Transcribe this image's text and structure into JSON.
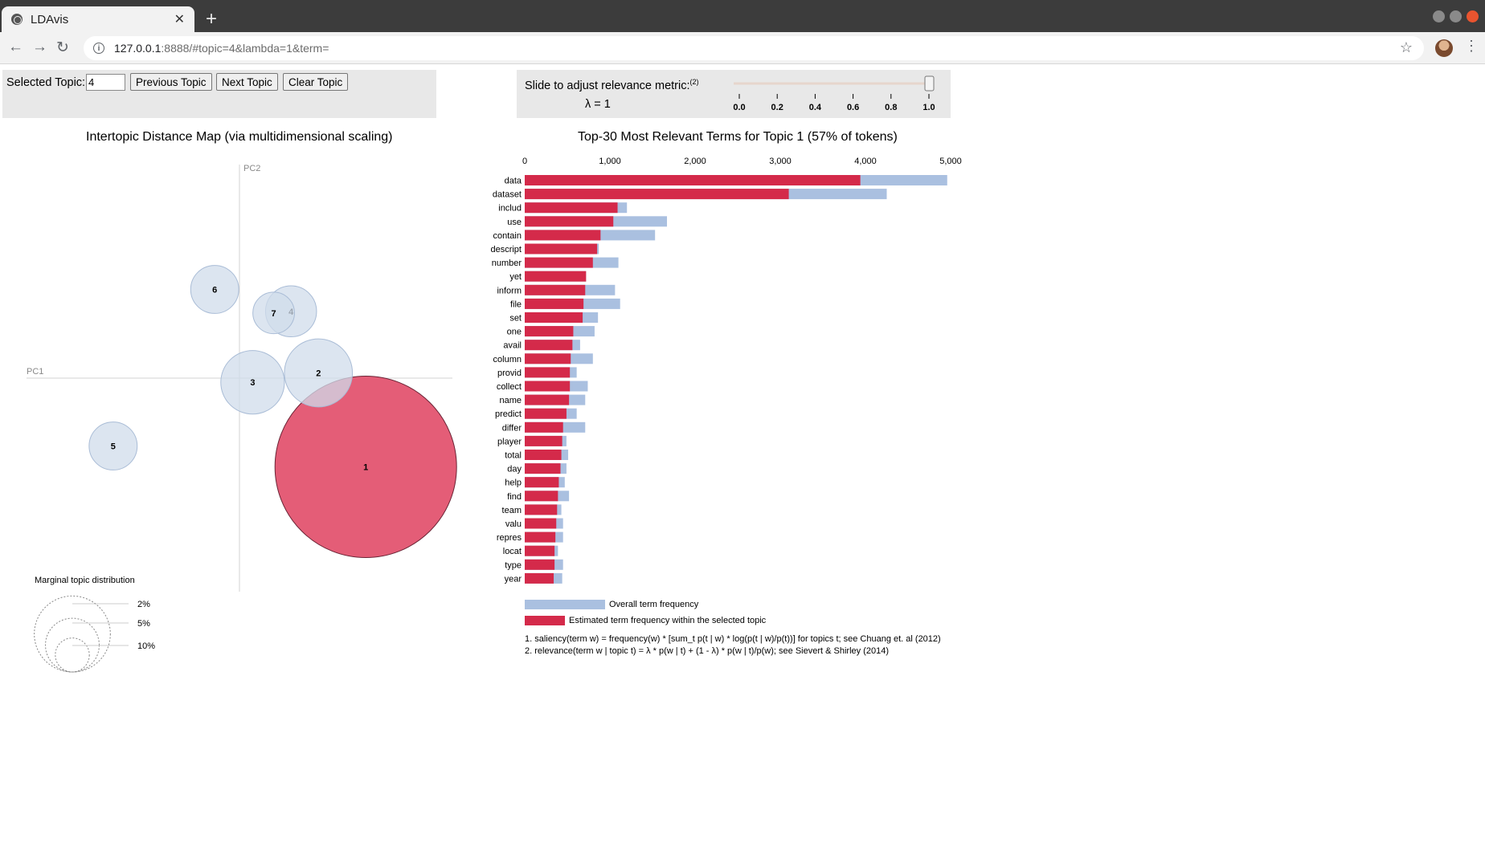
{
  "browser": {
    "tab_title": "LDAvis",
    "url_host": "127.0.0.1",
    "url_rest": ":8888/#topic=4&lambda=1&term=",
    "new_tab_label": "+",
    "close_label": "✕"
  },
  "controls": {
    "selected_topic_label": "Selected Topic:",
    "selected_topic_value": "4",
    "prev_label": "Previous Topic",
    "next_label": "Next Topic",
    "clear_label": "Clear Topic",
    "slide_label": "Slide to adjust relevance metric:",
    "slide_sup": "(2)",
    "lambda_label": "λ = 1",
    "lambda_value": 1.0,
    "slider_ticks": [
      "0.0",
      "0.2",
      "0.4",
      "0.6",
      "0.8",
      "1.0"
    ]
  },
  "map": {
    "title": "Intertopic Distance Map (via multidimensional scaling)",
    "pc1_label": "PC1",
    "pc2_label": "PC2",
    "legend_title": "Marginal topic distribution",
    "legend_items": [
      "2%",
      "5%",
      "10%"
    ],
    "topics": [
      {
        "id": "1",
        "selected": true
      },
      {
        "id": "2",
        "selected": false
      },
      {
        "id": "3",
        "selected": false
      },
      {
        "id": "4",
        "selected": false
      },
      {
        "id": "5",
        "selected": false
      },
      {
        "id": "6",
        "selected": false
      },
      {
        "id": "7",
        "selected": false
      }
    ]
  },
  "bars_panel": {
    "title": "Top-30 Most Relevant Terms for Topic 1 (57% of tokens)",
    "legend_overall": "Overall term frequency",
    "legend_estimated": "Estimated term frequency within the selected topic",
    "footnote1": "1. saliency(term w) = frequency(w) * [sum_t p(t | w) * log(p(t | w)/p(t))] for topics t; see Chuang et. al (2012)",
    "footnote2": "2. relevance(term w | topic t) = λ * p(w | t) + (1 - λ) * p(w | t)/p(w); see Sievert & Shirley (2014)"
  },
  "colors": {
    "overall": "#aac0e0",
    "estimated": "#d42a4a",
    "topic_circle": "#d0dceb",
    "selected_circle": "#e45d77"
  },
  "chart_data": [
    {
      "type": "bar",
      "orientation": "horizontal",
      "title": "Top-30 Most Relevant Terms for Topic 1 (57% of tokens)",
      "xlim": [
        0,
        5000
      ],
      "x_ticks": [
        "0",
        "1,000",
        "2,000",
        "3,000",
        "4,000",
        "5,000"
      ],
      "categories": [
        "data",
        "dataset",
        "includ",
        "use",
        "contain",
        "descript",
        "number",
        "yet",
        "inform",
        "file",
        "set",
        "one",
        "avail",
        "column",
        "provid",
        "collect",
        "name",
        "predict",
        "differ",
        "player",
        "total",
        "day",
        "help",
        "find",
        "team",
        "valu",
        "repres",
        "locat",
        "type",
        "year"
      ],
      "series": [
        {
          "name": "Overall term frequency",
          "values": [
            4960,
            4250,
            1200,
            1670,
            1530,
            870,
            1100,
            720,
            1060,
            1120,
            860,
            820,
            650,
            800,
            610,
            740,
            710,
            610,
            710,
            490,
            510,
            490,
            470,
            520,
            430,
            450,
            450,
            390,
            450,
            440
          ]
        },
        {
          "name": "Estimated term frequency within the selected topic",
          "values": [
            3940,
            3100,
            1090,
            1040,
            890,
            850,
            800,
            720,
            710,
            690,
            680,
            570,
            560,
            540,
            530,
            530,
            520,
            490,
            450,
            440,
            430,
            420,
            400,
            390,
            380,
            370,
            360,
            350,
            350,
            340
          ]
        }
      ]
    },
    {
      "type": "scatter",
      "title": "Intertopic Distance Map (via multidimensional scaling)",
      "xlabel": "PC1",
      "ylabel": "PC2",
      "points": [
        {
          "label": "1",
          "x": 0.24,
          "y": -0.17,
          "size_pct": 57
        },
        {
          "label": "2",
          "x": 0.15,
          "y": 0.01,
          "size_pct": 8
        },
        {
          "label": "3",
          "x": 0.025,
          "y": -0.008,
          "size_pct": 7
        },
        {
          "label": "4",
          "x": 0.098,
          "y": 0.128,
          "size_pct": 4.5
        },
        {
          "label": "5",
          "x": -0.24,
          "y": -0.13,
          "size_pct": 4
        },
        {
          "label": "6",
          "x": -0.047,
          "y": 0.17,
          "size_pct": 4
        },
        {
          "label": "7",
          "x": 0.065,
          "y": 0.125,
          "size_pct": 3
        }
      ]
    }
  ]
}
